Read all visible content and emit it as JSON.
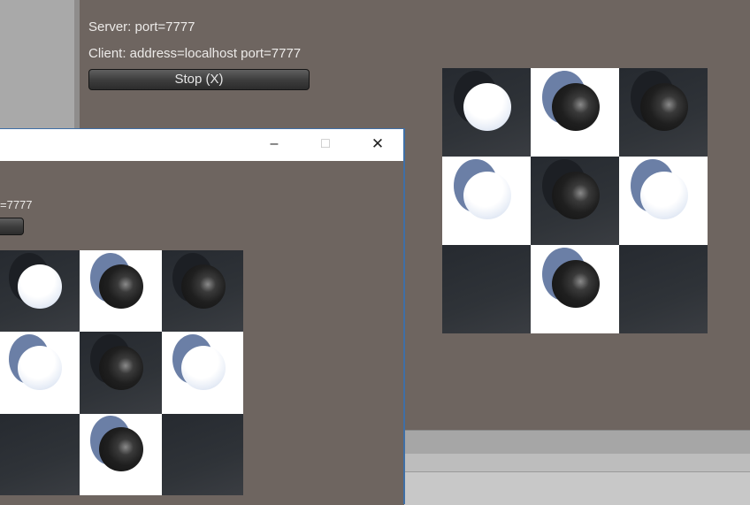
{
  "server_window": {
    "server_label": "Server: port=7777",
    "client_label": "Client: address=localhost port=7777",
    "stop_button": "Stop (X)"
  },
  "client_window": {
    "port_label_fragment": "=7777",
    "minimize_glyph": "–",
    "maximize_glyph": "□",
    "close_glyph": "✕"
  },
  "board": {
    "rows": 3,
    "cols": 3,
    "cells": [
      {
        "square": "dark",
        "piece": "white"
      },
      {
        "square": "white",
        "piece": "black"
      },
      {
        "square": "dark",
        "piece": "black"
      },
      {
        "square": "white",
        "piece": "white"
      },
      {
        "square": "dark",
        "piece": "black"
      },
      {
        "square": "white",
        "piece": "white"
      },
      {
        "square": "dark",
        "piece": "none"
      },
      {
        "square": "white",
        "piece": "black"
      },
      {
        "square": "dark",
        "piece": "none"
      }
    ]
  },
  "colors": {
    "background": "#6e6560",
    "dark_square": "#2c3035",
    "white_square": "#ffffff",
    "shadow_on_white": "#6b7fa6",
    "window_accent": "#3f6fa6"
  }
}
